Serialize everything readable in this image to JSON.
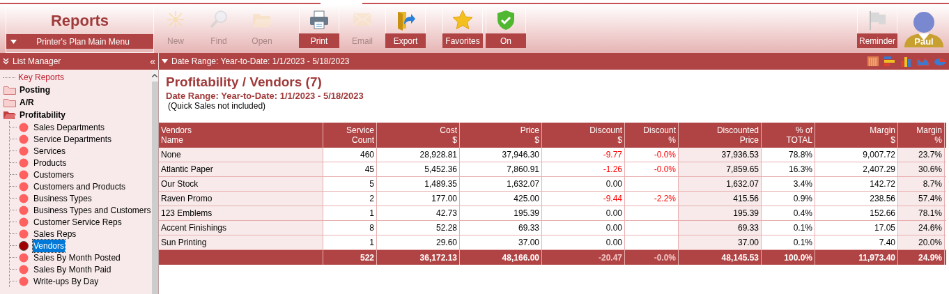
{
  "module": {
    "title": "Reports",
    "menu": "Printer's Plan Main Menu"
  },
  "toolbar": [
    {
      "label": "New",
      "disabled": true
    },
    {
      "label": "Find",
      "disabled": true
    },
    {
      "label": "Open",
      "disabled": true
    },
    {
      "label": "Print",
      "disabled": false
    },
    {
      "label": "Email",
      "disabled": true
    },
    {
      "label": "Export",
      "disabled": false
    },
    {
      "label": "Favorites",
      "disabled": false
    },
    {
      "label": "On",
      "disabled": false
    }
  ],
  "reminder": {
    "label": "Reminder"
  },
  "user": {
    "name": "Paul"
  },
  "list_manager": {
    "title": "List Manager",
    "collapse_glyph": "«"
  },
  "tree": [
    {
      "kind": "link",
      "label": "Key Reports"
    },
    {
      "kind": "folder",
      "label": "Posting",
      "expanded": false
    },
    {
      "kind": "folder",
      "label": "A/R",
      "expanded": false
    },
    {
      "kind": "folder",
      "label": "Profitability",
      "expanded": true,
      "children": [
        {
          "label": "Sales Departments",
          "selected": false
        },
        {
          "label": "Service Departments",
          "selected": false
        },
        {
          "label": "Services",
          "selected": false
        },
        {
          "label": "Products",
          "selected": false
        },
        {
          "label": "Customers",
          "selected": false
        },
        {
          "label": "Customers and Products",
          "selected": false
        },
        {
          "label": "Business Types",
          "selected": false
        },
        {
          "label": "Business Types and Customers",
          "selected": false
        },
        {
          "label": "Customer Service Reps",
          "selected": false
        },
        {
          "label": "Sales Reps",
          "selected": false
        },
        {
          "label": "Vendors",
          "selected": true
        },
        {
          "label": "Sales By Month Posted",
          "selected": false
        },
        {
          "label": "Sales By Month Paid",
          "selected": false
        },
        {
          "label": "Write-ups By Day",
          "selected": false
        }
      ]
    }
  ],
  "filter_bar": {
    "label": "Date Range: Year-to-Date: 1/1/2023 - 5/18/2023"
  },
  "report": {
    "title": "Profitability / Vendors (7)",
    "subtitle": "Date Range: Year-to-Date: 1/1/2023 - 5/18/2023",
    "note": "(Quick Sales not included)"
  },
  "table": {
    "columns": [
      {
        "lines": [
          "Vendors",
          "Name"
        ]
      },
      {
        "lines": [
          "Service",
          "Count"
        ]
      },
      {
        "lines": [
          "Cost",
          "$"
        ]
      },
      {
        "lines": [
          "Price",
          "$"
        ]
      },
      {
        "lines": [
          "Discount",
          "$"
        ]
      },
      {
        "lines": [
          "Discount",
          "%"
        ]
      },
      {
        "lines": [
          "Discounted",
          "Price"
        ]
      },
      {
        "lines": [
          "% of",
          "TOTAL"
        ]
      },
      {
        "lines": [
          "Margin",
          "$"
        ]
      },
      {
        "lines": [
          "Margin",
          "%"
        ]
      }
    ],
    "rows": [
      {
        "cells": [
          "None",
          "460",
          "28,928.81",
          "37,946.30",
          "-9.77",
          "-0.0%",
          "37,936.53",
          "78.8%",
          "9,007.72",
          "23.7%"
        ],
        "discount_negative": true
      },
      {
        "cells": [
          "Atlantic Paper",
          "45",
          "5,452.36",
          "7,860.91",
          "-1.26",
          "-0.0%",
          "7,859.65",
          "16.3%",
          "2,407.29",
          "30.6%"
        ],
        "discount_negative": true
      },
      {
        "cells": [
          "Our Stock",
          "5",
          "1,489.35",
          "1,632.07",
          "0.00",
          "",
          "1,632.07",
          "3.4%",
          "142.72",
          "8.7%"
        ],
        "discount_negative": false
      },
      {
        "cells": [
          "Raven Promo",
          "2",
          "177.00",
          "425.00",
          "-9.44",
          "-2.2%",
          "415.56",
          "0.9%",
          "238.56",
          "57.4%"
        ],
        "discount_negative": true
      },
      {
        "cells": [
          "123 Emblems",
          "1",
          "42.73",
          "195.39",
          "0.00",
          "",
          "195.39",
          "0.4%",
          "152.66",
          "78.1%"
        ],
        "discount_negative": false
      },
      {
        "cells": [
          "Accent Finishings",
          "8",
          "52.28",
          "69.33",
          "0.00",
          "",
          "69.33",
          "0.1%",
          "17.05",
          "24.6%"
        ],
        "discount_negative": false
      },
      {
        "cells": [
          "Sun Printing",
          "1",
          "29.60",
          "37.00",
          "0.00",
          "",
          "37.00",
          "0.1%",
          "7.40",
          "20.0%"
        ],
        "discount_negative": false
      }
    ],
    "totals": {
      "cells": [
        "",
        "522",
        "36,172.13",
        "48,166.00",
        "-20.47",
        "-0.0%",
        "48,145.53",
        "100.0%",
        "11,973.40",
        "24.9%"
      ],
      "discount_negative": true
    }
  }
}
